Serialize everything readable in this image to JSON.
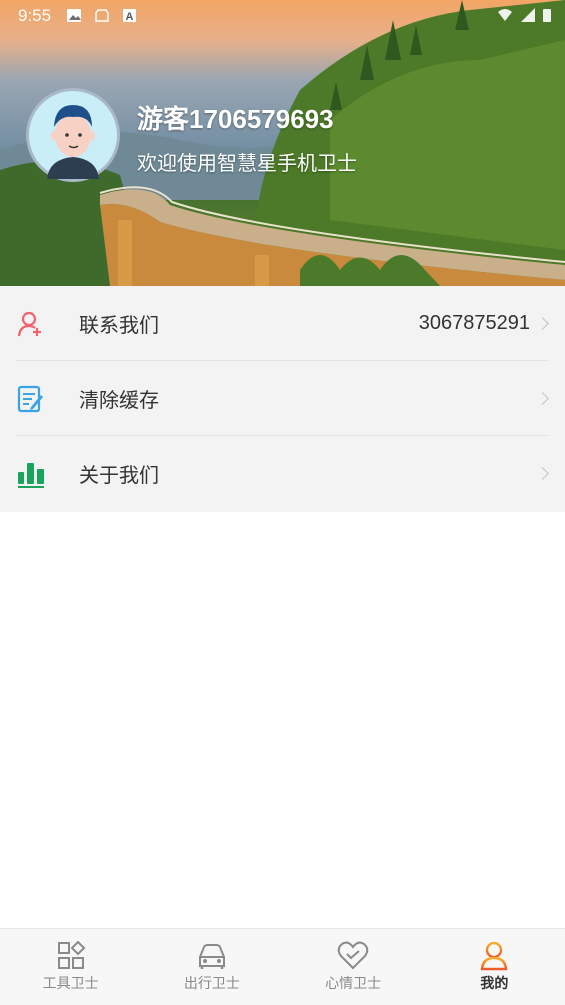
{
  "status_bar": {
    "time": "9:55"
  },
  "profile": {
    "username": "游客1706579693",
    "welcome": "欢迎使用智慧星手机卫士"
  },
  "menu": [
    {
      "label": "联系我们",
      "value": "3067875291",
      "icon": "contact-add-icon",
      "color": "#f0636a"
    },
    {
      "label": "清除缓存",
      "value": "",
      "icon": "edit-note-icon",
      "color": "#3aa3e8"
    },
    {
      "label": "关于我们",
      "value": "",
      "icon": "bar-chart-icon",
      "color": "#1aa35a"
    }
  ],
  "tabs": [
    {
      "label": "工具卫士",
      "icon": "grid-icon",
      "active": false
    },
    {
      "label": "出行卫士",
      "icon": "car-icon",
      "active": false
    },
    {
      "label": "心情卫士",
      "icon": "heart-icon",
      "active": false
    },
    {
      "label": "我的",
      "icon": "person-icon",
      "active": true
    }
  ],
  "colors": {
    "active_tab": "#f08a1c",
    "inactive_tab": "#8a8a8a",
    "menu_bg": "#f3f3f3"
  }
}
